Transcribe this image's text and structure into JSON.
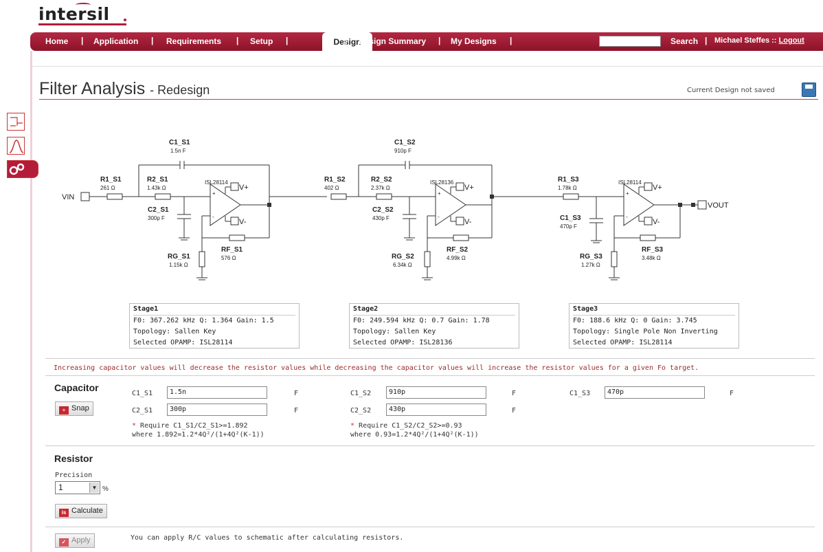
{
  "brand": {
    "logo_text": "intersil"
  },
  "nav": {
    "items": [
      "Home",
      "Application",
      "Requirements",
      "Setup",
      "Design",
      "Design Summary",
      "My Designs"
    ],
    "active": "Design",
    "search_label": "Search",
    "user": "Michael Steffes ::",
    "logout": "Logout"
  },
  "page": {
    "title": "Filter Analysis",
    "subtitle": "- Redesign",
    "save_status": "Current Design not saved"
  },
  "schematic": {
    "vin": "VIN",
    "vout": "VOUT",
    "vplus": "V+",
    "vminus": "V-",
    "stage1": {
      "c1": "C1_S1",
      "c1v": "1.5n F",
      "r1": "R1_S1",
      "r1v": "261 Ω",
      "r2": "R2_S1",
      "r2v": "1.43k Ω",
      "c2": "C2_S1",
      "c2v": "300p F",
      "opamp": "ISL28114",
      "rg": "RG_S1",
      "rgv": "1.15k Ω",
      "rf": "RF_S1",
      "rfv": "576 Ω"
    },
    "stage2": {
      "c1": "C1_S2",
      "c1v": "910p F",
      "r1": "R1_S2",
      "r1v": "402 Ω",
      "r2": "R2_S2",
      "r2v": "2.37k Ω",
      "c2": "C2_S2",
      "c2v": "430p F",
      "opamp": "ISL28136",
      "rg": "RG_S2",
      "rgv": "6.34k Ω",
      "rf": "RF_S2",
      "rfv": "4.99k Ω"
    },
    "stage3": {
      "r1": "R1_S3",
      "r1v": "1.78k Ω",
      "c1": "C1_S3",
      "c1v": "470p F",
      "opamp": "ISL28114",
      "rg": "RG_S3",
      "rgv": "1.27k Ω",
      "rf": "RF_S3",
      "rfv": "3.48k Ω"
    }
  },
  "stages": [
    {
      "name": "Stage1",
      "line1": "F0: 367.262 kHz  Q: 1.364  Gain: 1.5",
      "topology": "Topology: Sallen Key",
      "opamp": "Selected OPAMP: ISL28114"
    },
    {
      "name": "Stage2",
      "line1": "F0: 249.594 kHz  Q: 0.7  Gain: 1.78",
      "topology": "Topology: Sallen Key",
      "opamp": "Selected OPAMP: ISL28136"
    },
    {
      "name": "Stage3",
      "line1": "F0: 188.6 kHz   Q: 0  Gain: 3.745",
      "topology": "Topology: Single Pole Non Inverting",
      "opamp": "Selected OPAMP: ISL28114"
    }
  ],
  "info_text": "Increasing capacitor values will decrease the resistor values while decreasing the capacitor values will increase the resistor values for a given Fo target.",
  "capacitor": {
    "title": "Capacitor",
    "snap": "Snap",
    "unit": "F",
    "fields": [
      {
        "label": "C1_S1",
        "value": "1.5n"
      },
      {
        "label": "C2_S1",
        "value": "300p"
      },
      {
        "label": "C1_S2",
        "value": "910p"
      },
      {
        "label": "C2_S2",
        "value": "430p"
      },
      {
        "label": "C1_S3",
        "value": "470p"
      }
    ],
    "req1a": "Require C1_S1/C2_S1>=1.892",
    "req1b": "where 1.892=1.2*4Q²/(1+4Q²(K-1))",
    "req2a": "Require C1_S2/C2_S2>=0.93",
    "req2b": "where 0.93=1.2*4Q²/(1+4Q²(K-1))"
  },
  "resistor": {
    "title": "Resistor",
    "precision_label": "Precision",
    "precision_value": "1",
    "pct": "%",
    "calculate": "Calculate"
  },
  "apply": {
    "label": "Apply",
    "note": "You can apply R/C values to schematic after calculating resistors."
  }
}
